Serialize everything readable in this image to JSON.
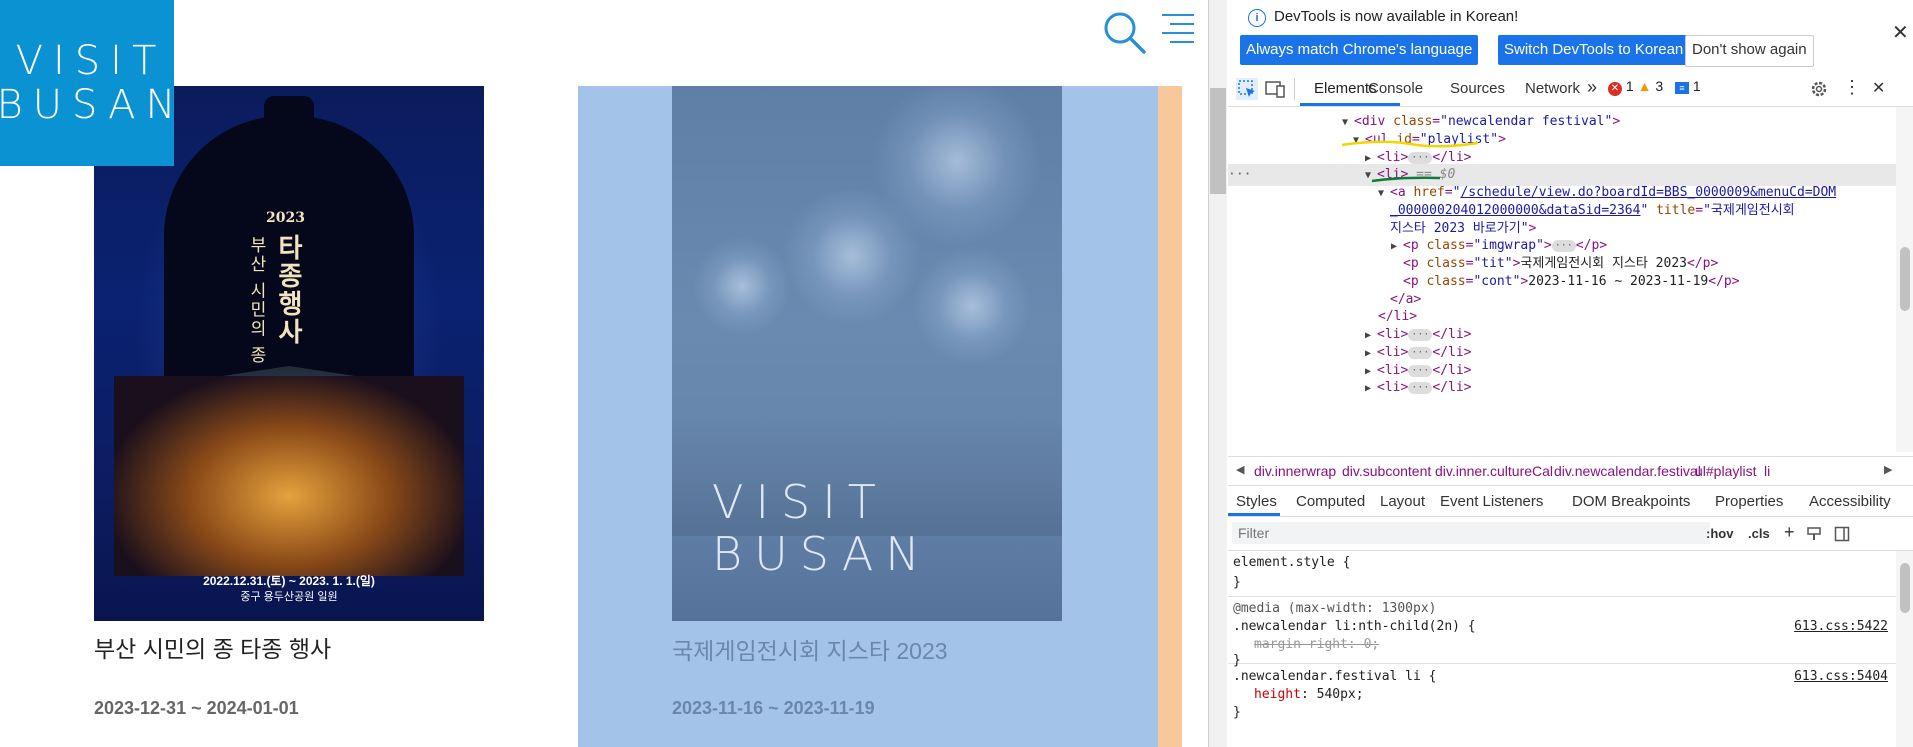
{
  "page": {
    "logo": {
      "line1": "VISIT",
      "line2": "BUSAN"
    },
    "cards": [
      {
        "title": "부산 시민의 종 타종 행사",
        "date": "2023-12-31 ~ 2024-01-01",
        "poster": {
          "year": "2023",
          "heading": "타종행사",
          "subheading": "부산 시민의 종",
          "dates": "2022.12.31.(토) ~ 2023. 1. 1.(일)",
          "place": "중구 용두산공원 일원"
        }
      },
      {
        "title": "국제게임전시회 지스타 2023",
        "date": "2023-11-16 ~ 2023-11-19",
        "placeholder_logo": {
          "line1": "VISIT",
          "line2": "BUSAN"
        }
      }
    ]
  },
  "devtools": {
    "infobar": {
      "message": "DevTools is now available in Korean!",
      "btn_match": "Always match Chrome's language",
      "btn_switch": "Switch DevTools to Korean",
      "btn_dont": "Don't show again"
    },
    "tabs": [
      "Elements",
      "Console",
      "Sources",
      "Network"
    ],
    "more_tabs": "»",
    "counts": {
      "errors": "1",
      "warnings": "3",
      "messages": "1"
    },
    "dom": {
      "div_class": "newcalendar festival",
      "ul_id": "playlist",
      "selected_marker": "== $0",
      "href_part1": "/schedule/view.do?boardId=BBS_0000009&menuCd=DOM",
      "href_part2": "_000000204012000000&dataSid=2364",
      "title_part1": "국제게임전시회",
      "title_part2": "지스타 2023 바로가기",
      "p1_class": "imgwrap",
      "p2_class": "tit",
      "p2_text": "국제게임전시회 지스타 2023",
      "p3_class": "cont",
      "p3_text": "2023-11-16 ~ 2023-11-19"
    },
    "breadcrumbs": [
      "div.innerwrap",
      "div.subcontent",
      "div.inner.cultureCal",
      "div.newcalendar.festival",
      "ul#playlist",
      "li"
    ],
    "subtabs": [
      "Styles",
      "Computed",
      "Layout",
      "Event Listeners",
      "DOM Breakpoints",
      "Properties",
      "Accessibility"
    ],
    "filter": {
      "placeholder": "Filter",
      "hov": ":hov",
      "cls": ".cls"
    },
    "styles": {
      "element_style": "element.style {",
      "close_brace": "}",
      "media": "@media (max-width: 1300px)",
      "rule1_selector": ".newcalendar li:nth-child(2n) {",
      "rule1_prop": "margin-right",
      "rule1_value": "0;",
      "rule1_src": "613.css:5422",
      "rule2_selector": ".newcalendar.festival li {",
      "rule2_prop": "height",
      "rule2_value": "540px;",
      "rule2_src": "613.css:5404"
    }
  }
}
